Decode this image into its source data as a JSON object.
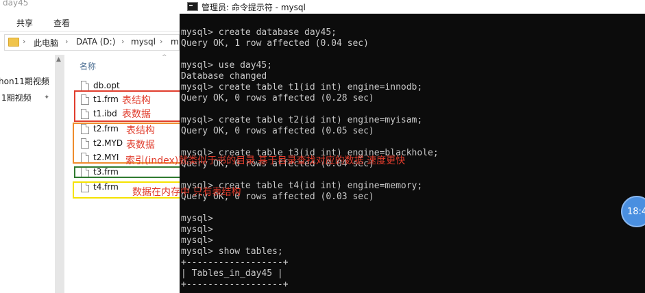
{
  "explorer": {
    "title": "day45",
    "ribbon": {
      "share": "共享",
      "view": "查看"
    },
    "address": {
      "crumbs": [
        "此电脑",
        "DATA (D:)",
        "mysql",
        "m"
      ]
    },
    "nav": [
      "hon11期视频",
      "1期视频"
    ],
    "column_header": "名称",
    "files": [
      "db.opt",
      "t1.frm",
      "t1.ibd",
      "t2.frm",
      "t2.MYD",
      "t2.MYI",
      "t3.frm",
      "t4.frm"
    ],
    "annotations": {
      "t1_frm": "表结构",
      "t1_ibd": "表数据",
      "t2_frm": "表结构",
      "t2_myd": "表数据",
      "t2_myi": "索引(index)就类似于书的目录  基于目录查找对应的数据 速度更快",
      "t4_frm": "数据在内存中 只有表结构"
    },
    "colors": {
      "red": "#e03c2c",
      "orange": "#ef8b2c",
      "green": "#2f7a2f",
      "yellow": "#f5e200"
    }
  },
  "console": {
    "title": "管理员: 命令提示符 - mysql",
    "lines": [
      "mysql> create database day45;",
      "Query OK, 1 row affected (0.04 sec)",
      "",
      "mysql> use day45;",
      "Database changed",
      "mysql> create table t1(id int) engine=innodb;",
      "Query OK, 0 rows affected (0.28 sec)",
      "",
      "mysql> create table t2(id int) engine=myisam;",
      "Query OK, 0 rows affected (0.05 sec)",
      "",
      "mysql> create table t3(id int) engine=blackhole;",
      "Query OK, 0 rows affected (0.04 sec)",
      "",
      "mysql> create table t4(id int) engine=memory;",
      "Query OK, 0 rows affected (0.03 sec)",
      "",
      "mysql>",
      "mysql>",
      "mysql>",
      "mysql> show tables;",
      "+------------------+",
      "| Tables_in_day45 |",
      "+------------------+"
    ]
  },
  "clock": "18:4"
}
